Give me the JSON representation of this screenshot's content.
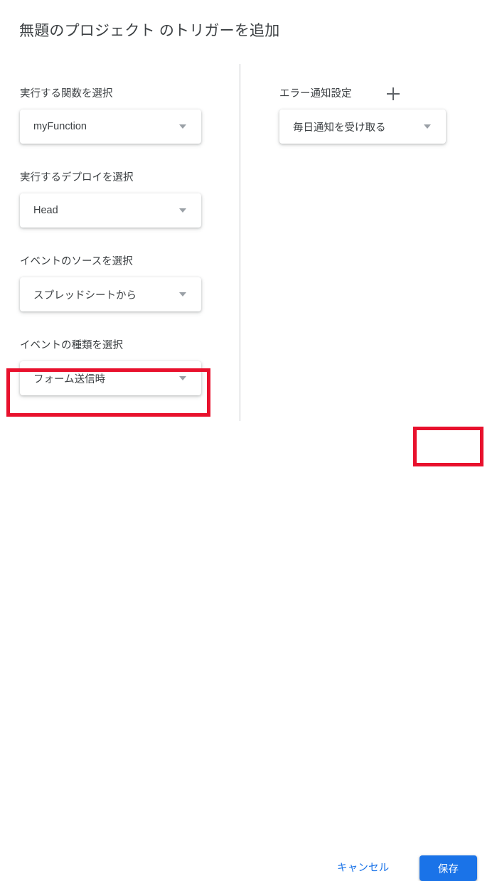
{
  "dialog": {
    "title": "無題のプロジェクト のトリガーを追加",
    "accent_color": "#1a73e8",
    "highlight_color": "#e8112d"
  },
  "left_column": {
    "fields": [
      {
        "label": "実行する関数を選択",
        "value": "myFunction",
        "arrow_icon": "chevron-down-icon"
      },
      {
        "label": "実行するデプロイを選択",
        "value": "Head",
        "arrow_icon": "chevron-down-icon"
      },
      {
        "label": "イベントのソースを選択",
        "value": "スプレッドシートから",
        "arrow_icon": "chevron-down-icon"
      },
      {
        "label": "イベントの種類を選択",
        "value": "フォーム送信時",
        "arrow_icon": "chevron-down-icon",
        "highlighted": true
      }
    ]
  },
  "right_column": {
    "field": {
      "label": "エラー通知設定",
      "add_icon": "plus-icon",
      "value": "毎日通知を受け取る",
      "arrow_icon": "chevron-down-icon"
    }
  },
  "footer": {
    "cancel_label": "キャンセル",
    "save_label": "保存",
    "save_highlighted": true
  }
}
